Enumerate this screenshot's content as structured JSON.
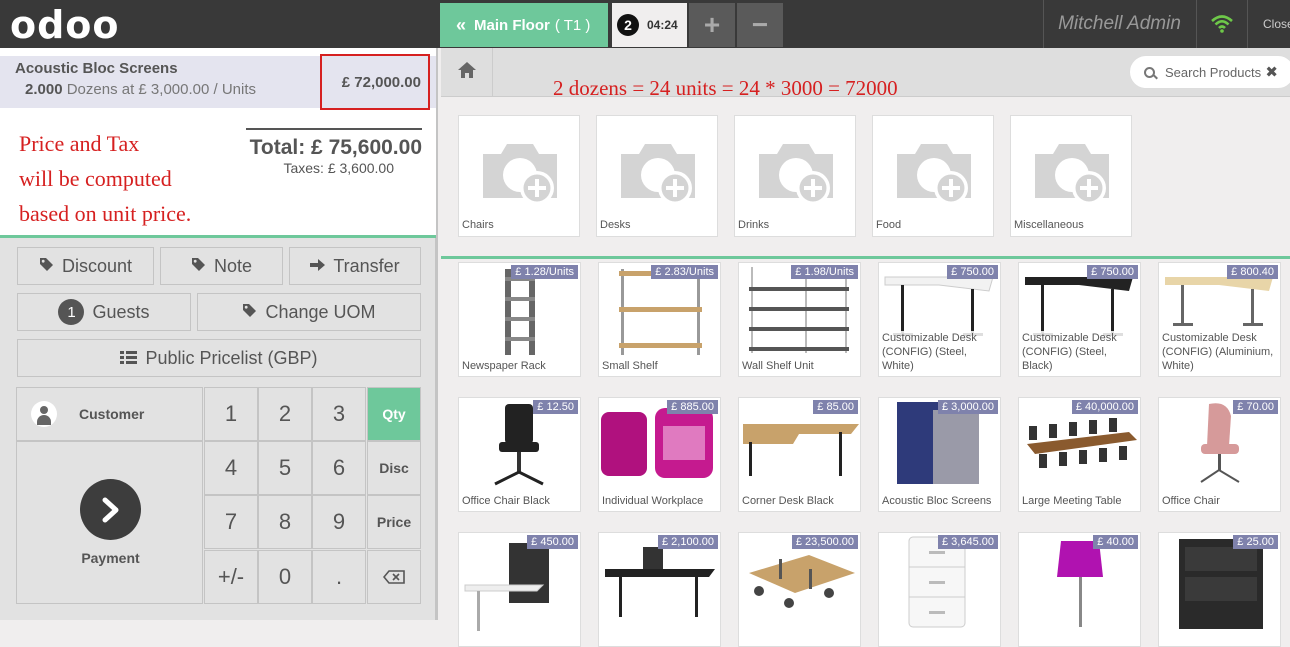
{
  "header": {
    "logo": "odoo",
    "floor_label": "Main Floor",
    "table_label": "( T1 )",
    "order_number": "2",
    "order_time": "04:24",
    "add_order": "+",
    "remove_order": "−",
    "user": "Mitchell Admin",
    "close": "Close"
  },
  "orderline": {
    "product": "Acoustic Bloc Screens",
    "qty": "2.000",
    "detail": " Dozens at £ 3,000.00 / Units",
    "price": "£ 72,000.00"
  },
  "annotations": {
    "left_line1": "Price and Tax",
    "left_line2": "will be computed",
    "left_line3": "based on unit price.",
    "right": "2 dozens = 24 units = 24 * 3000 = 72000"
  },
  "summary": {
    "total": "Total: £ 75,600.00",
    "taxes": "Taxes: £ 3,600.00"
  },
  "controls": {
    "discount": "Discount",
    "note": "Note",
    "transfer": "Transfer",
    "guests_count": "1",
    "guests": "Guests",
    "change_uom": "Change UOM",
    "pricelist": "Public Pricelist (GBP)"
  },
  "pad": {
    "customer": "Customer",
    "payment": "Payment",
    "keys": [
      "1",
      "2",
      "3",
      "4",
      "5",
      "6",
      "7",
      "8",
      "9",
      "+/-",
      "0",
      "."
    ],
    "qty": "Qty",
    "disc": "Disc",
    "price": "Price"
  },
  "search": {
    "placeholder": "Search Products"
  },
  "categories": [
    "Chairs",
    "Desks",
    "Drinks",
    "Food",
    "Miscellaneous"
  ],
  "products": [
    {
      "name": "Newspaper Rack",
      "price": "£ 1.28/Units"
    },
    {
      "name": "Small Shelf",
      "price": "£ 2.83/Units"
    },
    {
      "name": "Wall Shelf Unit",
      "price": "£ 1.98/Units"
    },
    {
      "name": "Customizable Desk (CONFIG) (Steel, White)",
      "price": "£ 750.00"
    },
    {
      "name": "Customizable Desk (CONFIG) (Steel, Black)",
      "price": "£ 750.00"
    },
    {
      "name": "Customizable Desk (CONFIG) (Aluminium, White)",
      "price": "£ 800.40"
    },
    {
      "name": "Office Chair Black",
      "price": "£ 12.50"
    },
    {
      "name": "Individual Workplace",
      "price": "£ 885.00"
    },
    {
      "name": "Corner Desk Black",
      "price": "£ 85.00"
    },
    {
      "name": "Acoustic Bloc Screens",
      "price": "£ 3,000.00"
    },
    {
      "name": "Large Meeting Table",
      "price": "£ 40,000.00"
    },
    {
      "name": "Office Chair",
      "price": "£ 70.00"
    },
    {
      "name": "",
      "price": "£ 450.00"
    },
    {
      "name": "",
      "price": "£ 2,100.00"
    },
    {
      "name": "",
      "price": "£ 23,500.00"
    },
    {
      "name": "",
      "price": "£ 3,645.00"
    },
    {
      "name": "",
      "price": "£ 40.00"
    },
    {
      "name": "",
      "price": "£ 25.00"
    }
  ],
  "colors": {
    "accent": "#6ec89b",
    "topbar": "#393939",
    "annotation": "#d62020",
    "price_tag": "#7f82ac"
  }
}
